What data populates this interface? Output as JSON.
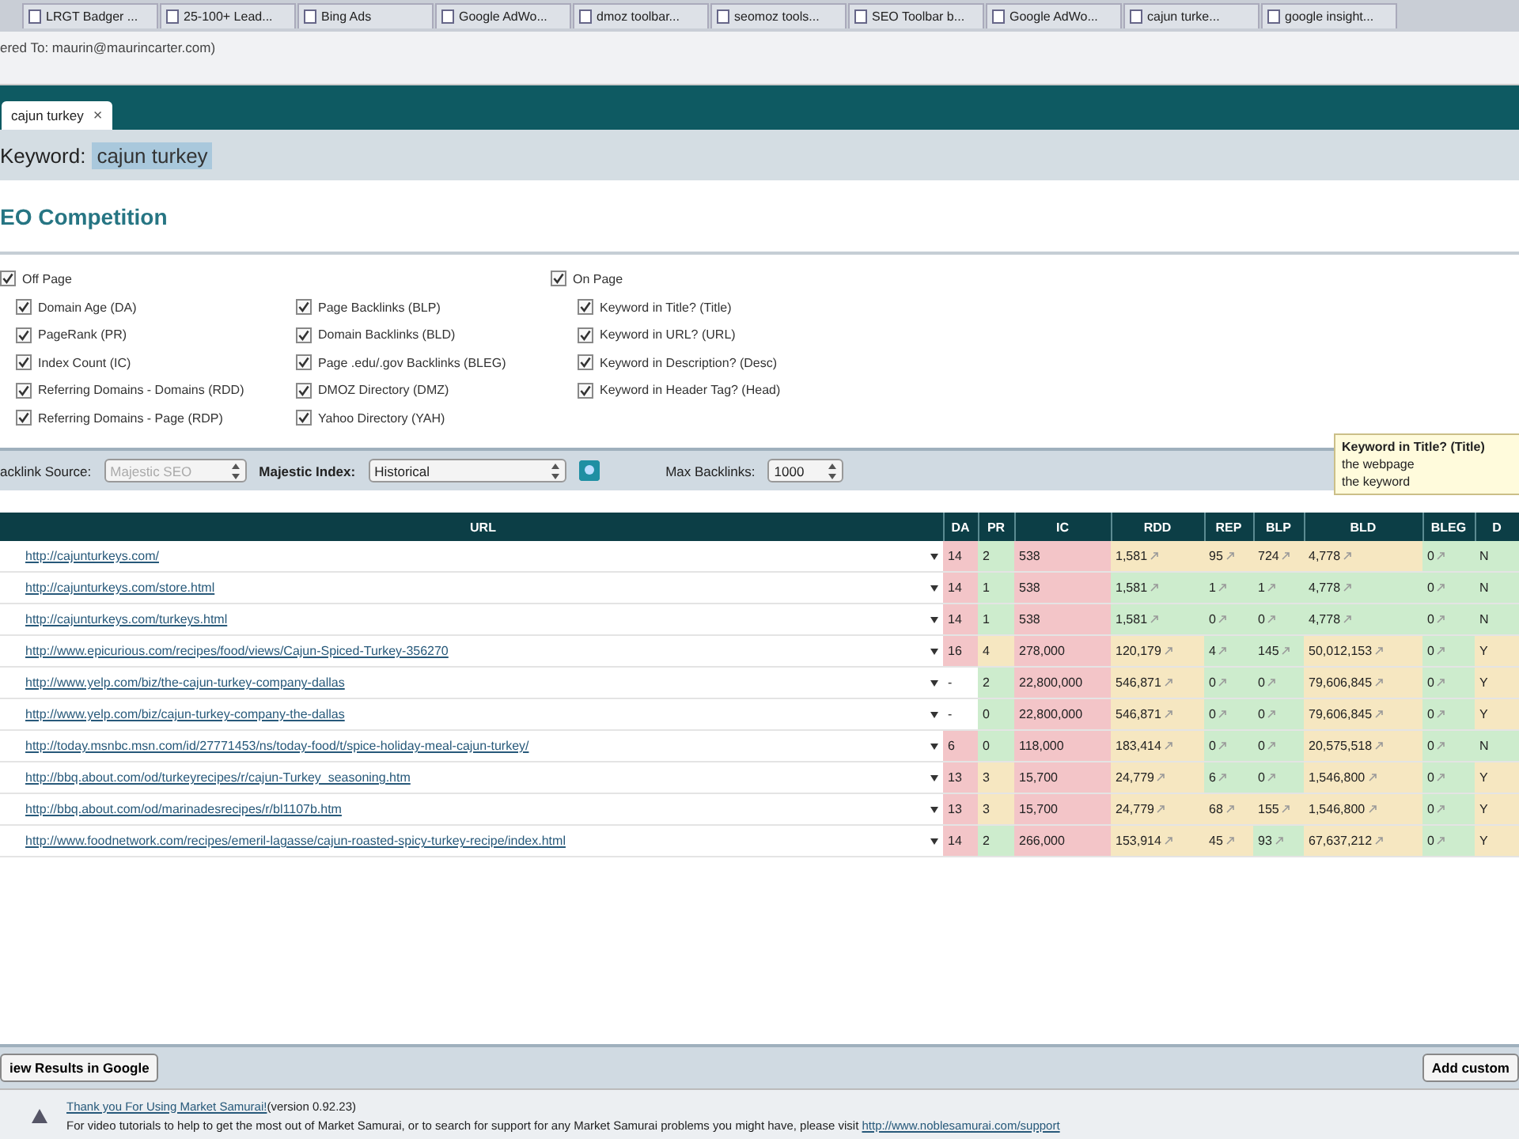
{
  "browser": {
    "bookmarks": [
      "LRGT Badger ...",
      "25-100+ Lead...",
      "Bing Ads",
      "Google AdWo...",
      "dmoz toolbar...",
      "seomoz tools...",
      "SEO Toolbar b...",
      "Google AdWo...",
      "cajun turke...",
      "google insight..."
    ],
    "status_text": "ered To: maurin@maurincarter.com)"
  },
  "app_tab": {
    "label": "cajun turkey",
    "close": "×"
  },
  "keyword": {
    "label": "Keyword:",
    "value": "cajun turkey"
  },
  "heading": "EO Competition",
  "off_page": {
    "label": "Off Page",
    "checked": true,
    "columns": [
      [
        {
          "label": "Domain Age (DA)",
          "checked": true
        },
        {
          "label": "PageRank (PR)",
          "checked": true
        },
        {
          "label": "Index Count (IC)",
          "checked": true
        },
        {
          "label": "Referring Domains - Domains (RDD)",
          "checked": true
        },
        {
          "label": "Referring Domains - Page (RDP)",
          "checked": true
        }
      ],
      [
        {
          "label": "Page Backlinks (BLP)",
          "checked": true
        },
        {
          "label": "Domain Backlinks (BLD)",
          "checked": true
        },
        {
          "label": "Page .edu/.gov Backlinks (BLEG)",
          "checked": true
        },
        {
          "label": "DMOZ Directory (DMZ)",
          "checked": true
        },
        {
          "label": "Yahoo Directory (YAH)",
          "checked": true
        }
      ]
    ]
  },
  "on_page": {
    "label": "On Page",
    "checked": true,
    "items": [
      {
        "label": "Keyword in Title? (Title)",
        "checked": true
      },
      {
        "label": "Keyword in URL? (URL)",
        "checked": true
      },
      {
        "label": "Keyword in Description? (Desc)",
        "checked": true
      },
      {
        "label": "Keyword in Header Tag? (Head)",
        "checked": true
      }
    ]
  },
  "options": {
    "backlink_source": {
      "label": "acklink Source:",
      "value": "Majestic SEO",
      "disabled": true
    },
    "majestic_index": {
      "label": "Majestic Index:",
      "value": "Historical"
    },
    "max_backlinks": {
      "label": "Max Backlinks:",
      "value": "1000"
    }
  },
  "tooltip": {
    "title": "Keyword in Title? (Title)",
    "lines": [
      "the webpage",
      "the keyword"
    ]
  },
  "table": {
    "columns": [
      {
        "label": "URL",
        "kind": "url"
      },
      {
        "label": "DA",
        "kind": "metric"
      },
      {
        "label": "PR",
        "kind": "metric"
      },
      {
        "label": "IC",
        "kind": "metric"
      },
      {
        "label": "RDD",
        "kind": "linked_metric"
      },
      {
        "label": "REP",
        "kind": "linked_metric"
      },
      {
        "label": "BLP",
        "kind": "linked_metric"
      },
      {
        "label": "BLD",
        "kind": "linked_metric"
      },
      {
        "label": "BLEG",
        "kind": "linked_metric"
      },
      {
        "label": "D",
        "kind": "metric"
      }
    ],
    "rows": [
      {
        "cells": [
          {
            "kind": "link",
            "text": "http://cajunturkeys.com/"
          },
          {
            "text": "14",
            "color": "#f3c5c8"
          },
          {
            "text": "2",
            "color": "#cdeccd"
          },
          {
            "text": "538",
            "color": "#f3c5c8"
          },
          {
            "text": "1,581",
            "color": "#f6e7c1"
          },
          {
            "text": "95",
            "color": "#f6e7c1"
          },
          {
            "text": "724",
            "color": "#f6e7c1"
          },
          {
            "text": "4,778",
            "color": "#f6e7c1"
          },
          {
            "text": "0",
            "color": "#cdeccd"
          },
          {
            "text": "N",
            "color": "#cdeccd"
          }
        ]
      },
      {
        "cells": [
          {
            "kind": "link",
            "text": "http://cajunturkeys.com/store.html"
          },
          {
            "text": "14",
            "color": "#f3c5c8"
          },
          {
            "text": "1",
            "color": "#cdeccd"
          },
          {
            "text": "538",
            "color": "#f3c5c8"
          },
          {
            "text": "1,581",
            "color": "#cdeccd"
          },
          {
            "text": "1",
            "color": "#cdeccd"
          },
          {
            "text": "1",
            "color": "#cdeccd"
          },
          {
            "text": "4,778",
            "color": "#cdeccd"
          },
          {
            "text": "0",
            "color": "#cdeccd"
          },
          {
            "text": "N",
            "color": "#cdeccd"
          }
        ]
      },
      {
        "cells": [
          {
            "kind": "link",
            "text": "http://cajunturkeys.com/turkeys.html"
          },
          {
            "text": "14",
            "color": "#f3c5c8"
          },
          {
            "text": "1",
            "color": "#cdeccd"
          },
          {
            "text": "538",
            "color": "#f3c5c8"
          },
          {
            "text": "1,581",
            "color": "#cdeccd"
          },
          {
            "text": "0",
            "color": "#cdeccd"
          },
          {
            "text": "0",
            "color": "#cdeccd"
          },
          {
            "text": "4,778",
            "color": "#cdeccd"
          },
          {
            "text": "0",
            "color": "#cdeccd"
          },
          {
            "text": "N",
            "color": "#cdeccd"
          }
        ]
      },
      {
        "cells": [
          {
            "kind": "link",
            "text": "http://www.epicurious.com/recipes/food/views/Cajun-Spiced-Turkey-356270"
          },
          {
            "text": "16",
            "color": "#f3c5c8"
          },
          {
            "text": "4",
            "color": "#f6e7c1"
          },
          {
            "text": "278,000",
            "color": "#f3c5c8"
          },
          {
            "text": "120,179",
            "color": "#f6e7c1"
          },
          {
            "text": "4",
            "color": "#cdeccd"
          },
          {
            "text": "145",
            "color": "#cdeccd"
          },
          {
            "text": "50,012,153",
            "color": "#f6e7c1"
          },
          {
            "text": "0",
            "color": "#cdeccd"
          },
          {
            "text": "Y",
            "color": "#f6e7c1"
          }
        ]
      },
      {
        "cells": [
          {
            "kind": "link",
            "text": "http://www.yelp.com/biz/the-cajun-turkey-company-dallas"
          },
          {
            "text": "-",
            "color": "#ffffff"
          },
          {
            "text": "2",
            "color": "#cdeccd"
          },
          {
            "text": "22,800,000",
            "color": "#f3c5c8"
          },
          {
            "text": "546,871",
            "color": "#f6e7c1"
          },
          {
            "text": "0",
            "color": "#cdeccd"
          },
          {
            "text": "0",
            "color": "#cdeccd"
          },
          {
            "text": "79,606,845",
            "color": "#f6e7c1"
          },
          {
            "text": "0",
            "color": "#cdeccd"
          },
          {
            "text": "Y",
            "color": "#f6e7c1"
          }
        ]
      },
      {
        "cells": [
          {
            "kind": "link",
            "text": "http://www.yelp.com/biz/cajun-turkey-company-the-dallas"
          },
          {
            "text": "-",
            "color": "#ffffff"
          },
          {
            "text": "0",
            "color": "#cdeccd"
          },
          {
            "text": "22,800,000",
            "color": "#f3c5c8"
          },
          {
            "text": "546,871",
            "color": "#f6e7c1"
          },
          {
            "text": "0",
            "color": "#cdeccd"
          },
          {
            "text": "0",
            "color": "#cdeccd"
          },
          {
            "text": "79,606,845",
            "color": "#f6e7c1"
          },
          {
            "text": "0",
            "color": "#cdeccd"
          },
          {
            "text": "Y",
            "color": "#f6e7c1"
          }
        ]
      },
      {
        "cells": [
          {
            "kind": "link",
            "text": "http://today.msnbc.msn.com/id/27771453/ns/today-food/t/spice-holiday-meal-cajun-turkey/"
          },
          {
            "text": "6",
            "color": "#f3c5c8"
          },
          {
            "text": "0",
            "color": "#cdeccd"
          },
          {
            "text": "118,000",
            "color": "#f3c5c8"
          },
          {
            "text": "183,414",
            "color": "#f6e7c1"
          },
          {
            "text": "0",
            "color": "#cdeccd"
          },
          {
            "text": "0",
            "color": "#cdeccd"
          },
          {
            "text": "20,575,518",
            "color": "#f6e7c1"
          },
          {
            "text": "0",
            "color": "#cdeccd"
          },
          {
            "text": "N",
            "color": "#cdeccd"
          }
        ]
      },
      {
        "cells": [
          {
            "kind": "link",
            "text": "http://bbq.about.com/od/turkeyrecipes/r/cajun-Turkey_seasoning.htm"
          },
          {
            "text": "13",
            "color": "#f3c5c8"
          },
          {
            "text": "3",
            "color": "#f6e7c1"
          },
          {
            "text": "15,700",
            "color": "#f3c5c8"
          },
          {
            "text": "24,779",
            "color": "#f6e7c1"
          },
          {
            "text": "6",
            "color": "#cdeccd"
          },
          {
            "text": "0",
            "color": "#cdeccd"
          },
          {
            "text": "1,546,800",
            "color": "#f6e7c1"
          },
          {
            "text": "0",
            "color": "#cdeccd"
          },
          {
            "text": "Y",
            "color": "#f6e7c1"
          }
        ]
      },
      {
        "cells": [
          {
            "kind": "link",
            "text": "http://bbq.about.com/od/marinadesrecipes/r/bl1107b.htm"
          },
          {
            "text": "13",
            "color": "#f3c5c8"
          },
          {
            "text": "3",
            "color": "#f6e7c1"
          },
          {
            "text": "15,700",
            "color": "#f3c5c8"
          },
          {
            "text": "24,779",
            "color": "#f6e7c1"
          },
          {
            "text": "68",
            "color": "#f6e7c1"
          },
          {
            "text": "155",
            "color": "#f6e7c1"
          },
          {
            "text": "1,546,800",
            "color": "#f6e7c1"
          },
          {
            "text": "0",
            "color": "#cdeccd"
          },
          {
            "text": "Y",
            "color": "#f6e7c1"
          }
        ]
      },
      {
        "cells": [
          {
            "kind": "link",
            "text": "http://www.foodnetwork.com/recipes/emeril-lagasse/cajun-roasted-spicy-turkey-recipe/index.html"
          },
          {
            "text": "14",
            "color": "#f3c5c8"
          },
          {
            "text": "2",
            "color": "#cdeccd"
          },
          {
            "text": "266,000",
            "color": "#f3c5c8"
          },
          {
            "text": "153,914",
            "color": "#f6e7c1"
          },
          {
            "text": "45",
            "color": "#f6e7c1"
          },
          {
            "text": "93",
            "color": "#cdeccd"
          },
          {
            "text": "67,637,212",
            "color": "#f6e7c1"
          },
          {
            "text": "0",
            "color": "#cdeccd"
          },
          {
            "text": "Y",
            "color": "#f6e7c1"
          }
        ]
      }
    ]
  },
  "buttons": {
    "left": "iew Results in Google",
    "right": "Add custom"
  },
  "footer": {
    "thanks": "Thank you For Using Market Samurai!",
    "version": "(version 0.92.23)",
    "message": "For video tutorials to help to get the most out of Market Samurai, or to search for support for any Market Samurai problems you might have, please visit",
    "link": "http://www.noblesamurai.com/support"
  }
}
